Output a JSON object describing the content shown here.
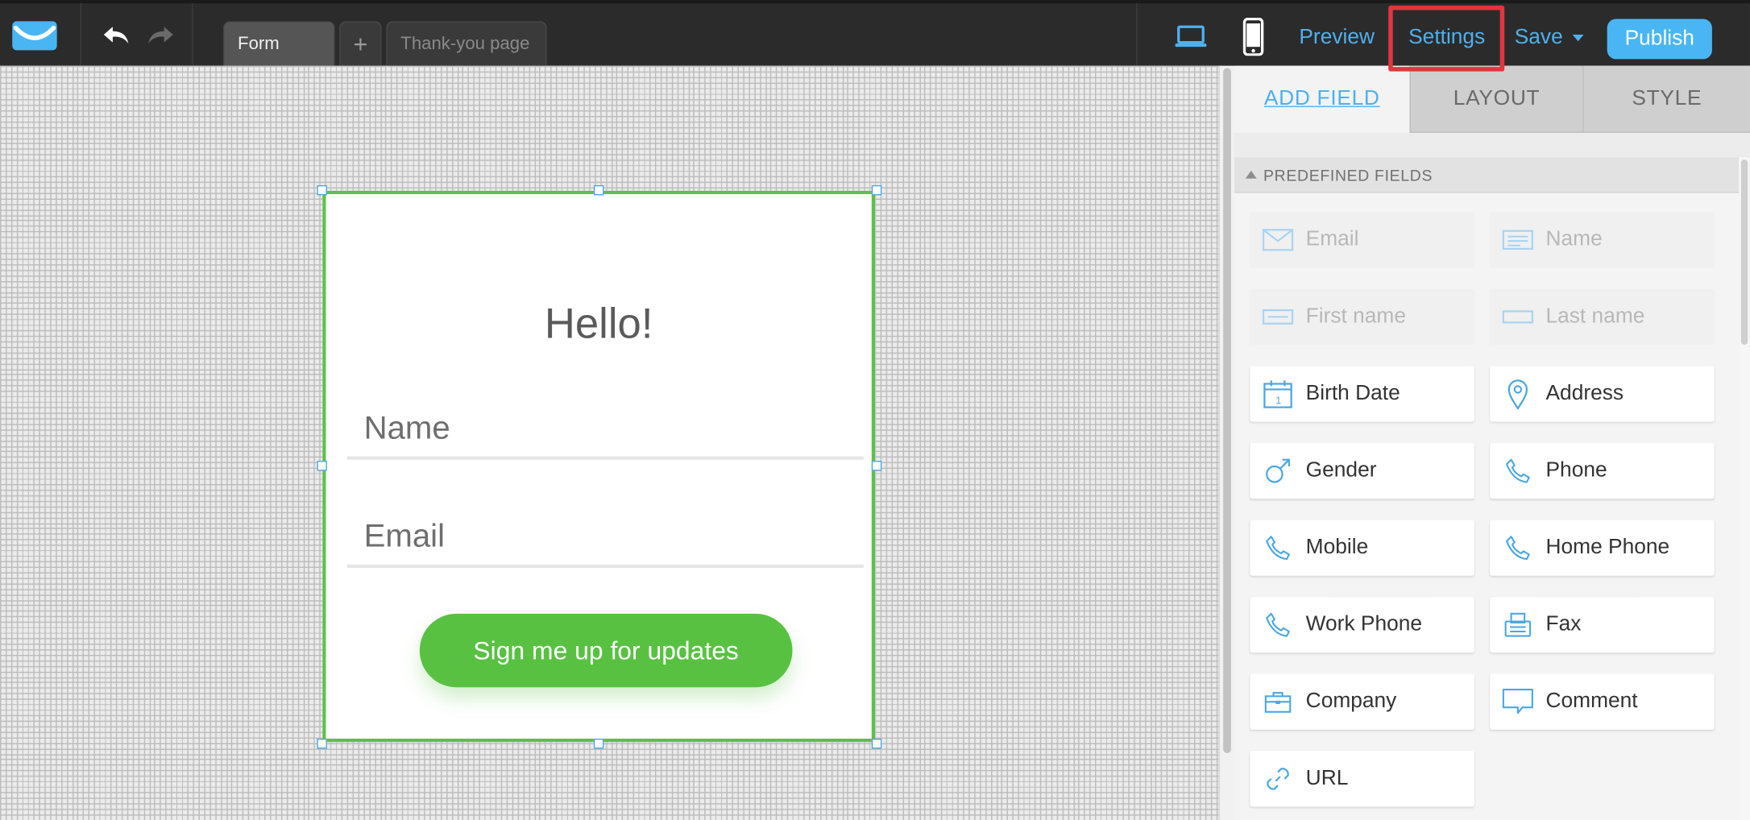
{
  "toolbar": {
    "tabs": [
      {
        "label": "Form"
      },
      {
        "label": "+"
      },
      {
        "label": "Thank-you page"
      }
    ],
    "links": {
      "preview": "Preview",
      "settings": "Settings",
      "save": "Save",
      "publish": "Publish"
    }
  },
  "form": {
    "title": "Hello!",
    "name_placeholder": "Name",
    "email_placeholder": "Email",
    "submit_label": "Sign me up for updates"
  },
  "panel": {
    "tabs": {
      "add_field": "ADD FIELD",
      "layout": "LAYOUT",
      "style": "STYLE"
    },
    "section_title": "PREDEFINED FIELDS",
    "fields": [
      {
        "label": "Email",
        "icon": "envelope-icon",
        "state": "used"
      },
      {
        "label": "Name",
        "icon": "text-lines-icon",
        "state": "used"
      },
      {
        "label": "First name",
        "icon": "text-field-icon",
        "state": "used"
      },
      {
        "label": "Last name",
        "icon": "text-field-icon",
        "state": "used"
      },
      {
        "label": "Birth Date",
        "icon": "calendar-icon",
        "state": "available"
      },
      {
        "label": "Address",
        "icon": "map-pin-icon",
        "state": "available"
      },
      {
        "label": "Gender",
        "icon": "male-symbol-icon",
        "state": "available"
      },
      {
        "label": "Phone",
        "icon": "phone-icon",
        "state": "available"
      },
      {
        "label": "Mobile",
        "icon": "phone-icon",
        "state": "available"
      },
      {
        "label": "Home Phone",
        "icon": "phone-icon",
        "state": "available"
      },
      {
        "label": "Work Phone",
        "icon": "phone-icon",
        "state": "available"
      },
      {
        "label": "Fax",
        "icon": "fax-icon",
        "state": "available"
      },
      {
        "label": "Company",
        "icon": "briefcase-icon",
        "state": "available"
      },
      {
        "label": "Comment",
        "icon": "speech-bubble-icon",
        "state": "available"
      },
      {
        "label": "URL",
        "icon": "link-icon",
        "state": "available"
      }
    ]
  },
  "colors": {
    "accent": "#4fb0ec",
    "topbar": "#2b2b2b",
    "form_border": "#5cc14a",
    "submit_button": "#58c142",
    "highlight_box": "#e0363d"
  }
}
